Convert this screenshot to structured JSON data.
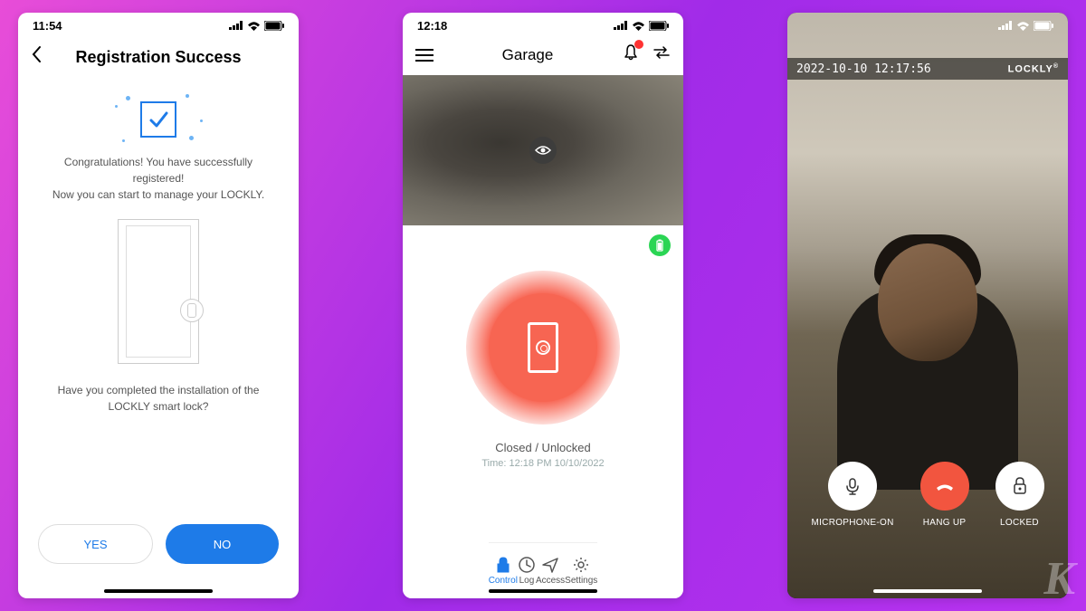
{
  "screen1": {
    "status_time": "11:54",
    "title": "Registration Success",
    "congrats_line1": "Congratulations! You have successfully registered!",
    "congrats_line2": "Now you can start to manage your LOCKLY.",
    "prompt_line1": "Have you completed the installation of the",
    "prompt_line2": "LOCKLY smart lock?",
    "yes_label": "YES",
    "no_label": "NO"
  },
  "screen2": {
    "status_time": "12:18",
    "header_title": "Garage",
    "lock_status": "Closed / Unlocked",
    "time_label": "Time:",
    "time_value": "12:18 PM 10/10/2022",
    "tabs": {
      "control": "Control",
      "log": "Log",
      "access": "Access",
      "settings": "Settings"
    }
  },
  "screen3": {
    "timestamp": "2022-10-10 12:17:56",
    "brand": "LOCKLY",
    "mic_label": "MICROPHONE-ON",
    "hangup_label": "HANG UP",
    "locked_label": "LOCKED"
  },
  "watermark": "K"
}
